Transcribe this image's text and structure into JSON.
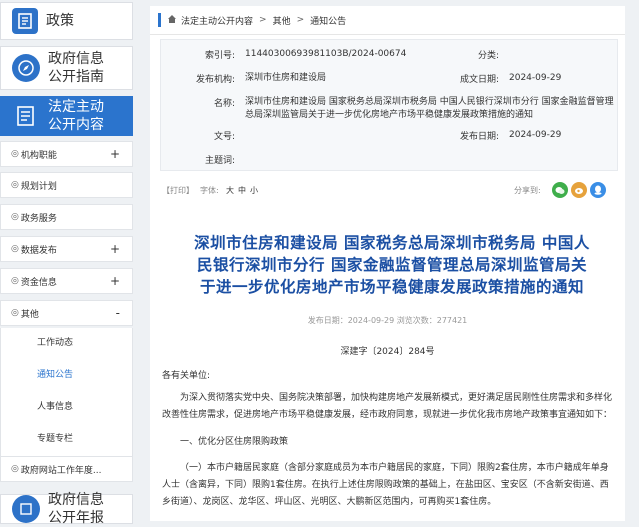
{
  "sidebar": {
    "tiles": {
      "policy": "政策",
      "guide_l1": "政府信息",
      "guide_l2": "公开指南",
      "active_l1": "法定主动",
      "active_l2": "公开内容",
      "annual_l1": "政府信息",
      "annual_l2": "公开年报"
    },
    "menu": [
      {
        "label": "机构职能",
        "tail": "+"
      },
      {
        "label": "规划计划",
        "tail": ""
      },
      {
        "label": "政务服务",
        "tail": ""
      },
      {
        "label": "数据发布",
        "tail": "+"
      },
      {
        "label": "资金信息",
        "tail": "+"
      },
      {
        "label": "其他",
        "tail": "-"
      },
      {
        "label": "政府网站工作年度...",
        "tail": ""
      }
    ],
    "menu_prefix": "◎",
    "subitems": [
      "工作动态",
      "通知公告",
      "人事信息",
      "专题专栏"
    ]
  },
  "breadcrumb": {
    "home": "法定主动公开内容",
    "sep": ">",
    "level2": "其他",
    "level3": "通知公告"
  },
  "meta": {
    "index_label": "索引号:",
    "index_value": "11440300693981103B/2024-00674",
    "category_label": "分类:",
    "category_value": "",
    "org_label": "发布机构:",
    "org_value": "深圳市住房和建设局",
    "date_label": "成文日期:",
    "date_value": "2024-09-29",
    "name_label": "名称:",
    "name_value_l1": "深圳市住房和建设局 国家税务总局深圳市税务局 中国人民银行深圳市分行 国家金融监督管理",
    "name_value_l2": "总局深圳监管局关于进一步优化房地产市场平稳健康发展政策措施的通知",
    "docno_label": "文号:",
    "docno_value": "",
    "pubdate_label": "发布日期:",
    "pubdate_value": "2024-09-29",
    "topic_label": "主题词:",
    "topic_value": ""
  },
  "toolbar": {
    "print": "【打印】",
    "font": "字体:",
    "font_large": "大",
    "font_medium": "中",
    "font_small": "小",
    "share": "分享到:"
  },
  "article": {
    "title_l1": "深圳市住房和建设局 国家税务总局深圳市税务局 中国人",
    "title_l2": "民银行深圳市分行 国家金融监督管理总局深圳监管局关",
    "title_l3": "于进一步优化房地产市场平稳健康发展政策措施的通知",
    "pub_info": "发布日期：2024-09-29 浏览次数：277421",
    "doc_number": "深建字〔2024〕284号",
    "salutation": "各有关单位:",
    "para1_l1": "为深入贯彻落实党中央、国务院决策部署，加快构建房地产发展新模式，更好满足居民刚性住房需求和多样化",
    "para1_l2": "改善性住房需求，促进房地产市场平稳健康发展，经市政府同意，现就进一步优化我市房地产政策事宜通知如下：",
    "section1": "一、优化分区住房限购政策",
    "para2_l1": "（一）本市户籍居民家庭（含部分家庭成员为本市户籍居民的家庭，下同）限购2套住房，本市户籍成年单身",
    "para2_l2": "人士（含离异，下同）限购1套住房。在执行上述住房限购政策的基础上，在盐田区、宝安区（不含新安街道、西",
    "para2_l3": "乡街道）、龙岗区、龙华区、坪山区、光明区、大鹏新区范围内，可再购买1套住房。"
  },
  "colors": {
    "accent": "#2b74cd",
    "title": "#1b4fa3",
    "wechat": "#3fae4b",
    "weibo": "#e6a23c",
    "qq": "#3a8ee6"
  }
}
